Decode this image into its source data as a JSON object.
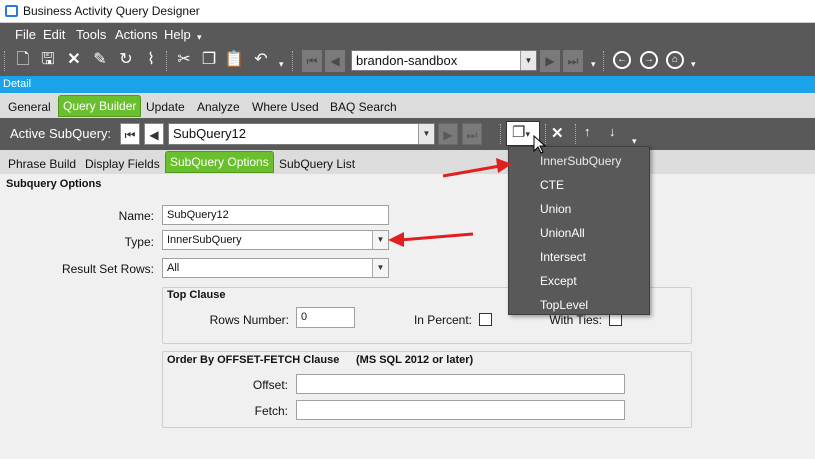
{
  "window": {
    "title": "Business Activity Query Designer"
  },
  "menu": [
    "File",
    "Edit",
    "Tools",
    "Actions",
    "Help"
  ],
  "toolbar": {
    "icons": [
      "new-icon",
      "save-icon",
      "delete-icon",
      "edit-icon",
      "refresh-icon",
      "clear-icon",
      "cut-icon",
      "copy-icon",
      "paste-icon",
      "undo-icon"
    ],
    "company": "brandon-sandbox"
  },
  "detail_label": "Detail",
  "tabs": [
    "General",
    "Query Builder",
    "Update",
    "Analyze",
    "Where Used",
    "BAQ Search"
  ],
  "active_tab": "Query Builder",
  "subquery_bar": {
    "label": "Active SubQuery:",
    "value": "SubQuery12"
  },
  "subtabs": [
    "Phrase Build",
    "Display Fields",
    "SubQuery Options",
    "SubQuery List"
  ],
  "active_subtab": "SubQuery Options",
  "options": {
    "section_title": "Subquery Options",
    "name_label": "Name:",
    "name_value": "SubQuery12",
    "type_label": "Type:",
    "type_value": "InnerSubQuery",
    "rows_label": "Result Set Rows:",
    "rows_value": "All"
  },
  "top_clause": {
    "title": "Top Clause",
    "rows_number_label": "Rows Number:",
    "rows_number_value": "0",
    "in_percent_label": "In Percent:",
    "with_ties_label": "With Ties:"
  },
  "order_by": {
    "title": "Order By OFFSET-FETCH Clause",
    "note": "(MS SQL 2012 or later)",
    "offset_label": "Offset:",
    "offset_value": "",
    "fetch_label": "Fetch:",
    "fetch_value": ""
  },
  "type_dropdown": {
    "options": [
      "InnerSubQuery",
      "CTE",
      "Union",
      "UnionAll",
      "Intersect",
      "Except",
      "TopLevel"
    ],
    "selected": "InnerSubQuery"
  },
  "colors": {
    "dark": "#595959",
    "accent": "#1aa3e8",
    "active_tab": "#6abf2e",
    "arrow": "#e02020"
  }
}
